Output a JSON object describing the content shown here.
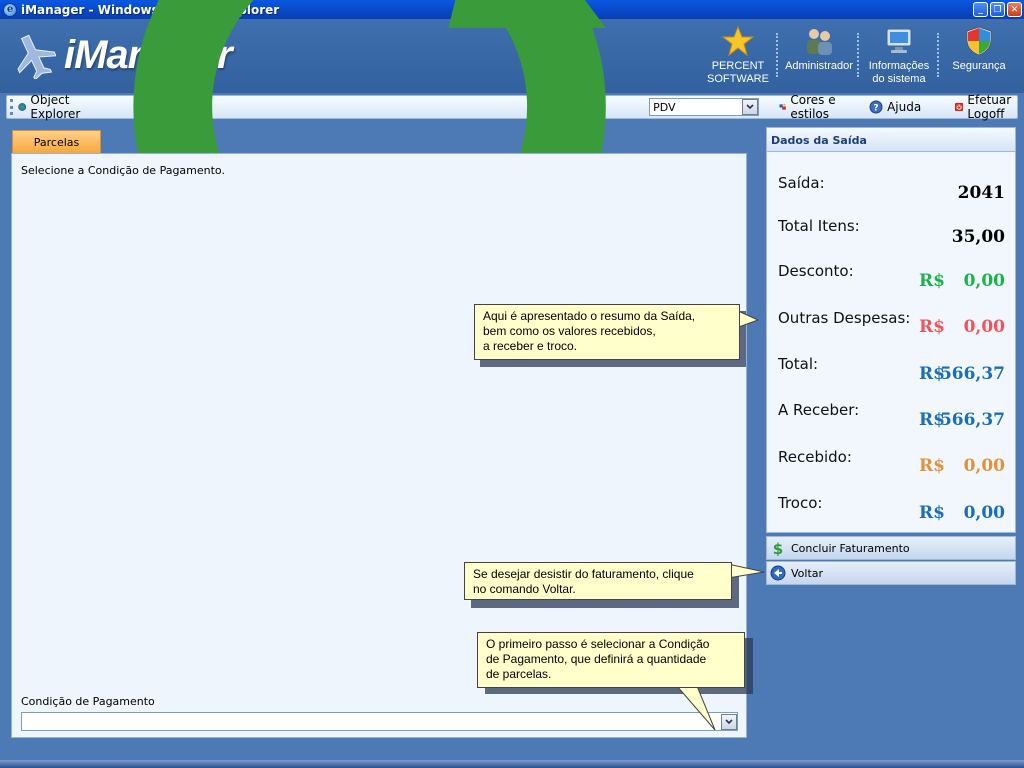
{
  "window": {
    "title": "iManager - Windows Internet Explorer",
    "ie_glyph": "e",
    "controls": {
      "minimize": "_",
      "restore": "❐",
      "close": "✕"
    }
  },
  "header": {
    "logo_text": "iManager",
    "items": [
      {
        "label_line1": "PERCENT",
        "label_line2": "SOFTWARE",
        "icon": "star-icon"
      },
      {
        "label_line1": "Administrador",
        "label_line2": "",
        "icon": "users-icon"
      },
      {
        "label_line1": "Informações",
        "label_line2": "do sistema",
        "icon": "computer-icon"
      },
      {
        "label_line1": "Segurança",
        "label_line2": "",
        "icon": "shield-icon"
      }
    ]
  },
  "toolbar": {
    "object_explorer": "Object Explorer",
    "pdv_value": "PDV",
    "cores": "Cores e estilos",
    "ajuda": "Ajuda",
    "logoff": "Efetuar Logoff"
  },
  "left": {
    "tab": "Parcelas",
    "instruction": "Selecione a Condição de Pagamento.",
    "cond_label": "Condição de Pagamento",
    "cond_value": ""
  },
  "right": {
    "header": "Dados da Saída",
    "rows": [
      {
        "label": "Saída:",
        "currency": "",
        "value": "2041",
        "color": "#000000"
      },
      {
        "label": "Total Itens:",
        "currency": "",
        "value": "35,00",
        "color": "#000000"
      },
      {
        "label": "Desconto:",
        "currency": "R$",
        "value": "0,00",
        "color": "#19b34a"
      },
      {
        "label": "Outras Despesas:",
        "currency": "R$",
        "value": "0,00",
        "color": "#f0545a"
      },
      {
        "label": "Total:",
        "currency": "R$",
        "value": "566,37",
        "color": "#1a6dbb"
      },
      {
        "label": "A Receber:",
        "currency": "R$",
        "value": "566,37",
        "color": "#1a6dbb"
      },
      {
        "label": "Recebido:",
        "currency": "R$",
        "value": "0,00",
        "color": "#e0913a"
      },
      {
        "label": "Troco:",
        "currency": "R$",
        "value": "0,00",
        "color": "#1a6dbb"
      }
    ],
    "btn_concluir": "Concluir Faturamento",
    "btn_voltar": "Voltar"
  },
  "callouts": {
    "resumo": "Aqui é apresentado o resumo da Saída,\nbem como os valores recebidos,\na receber e troco.",
    "voltar": "Se desejar desistir do faturamento, clique\nno comando Voltar.",
    "condicao": "O primeiro passo é selecionar a Condição\nde Pagamento, que definirá a quantidade\nde parcelas."
  }
}
